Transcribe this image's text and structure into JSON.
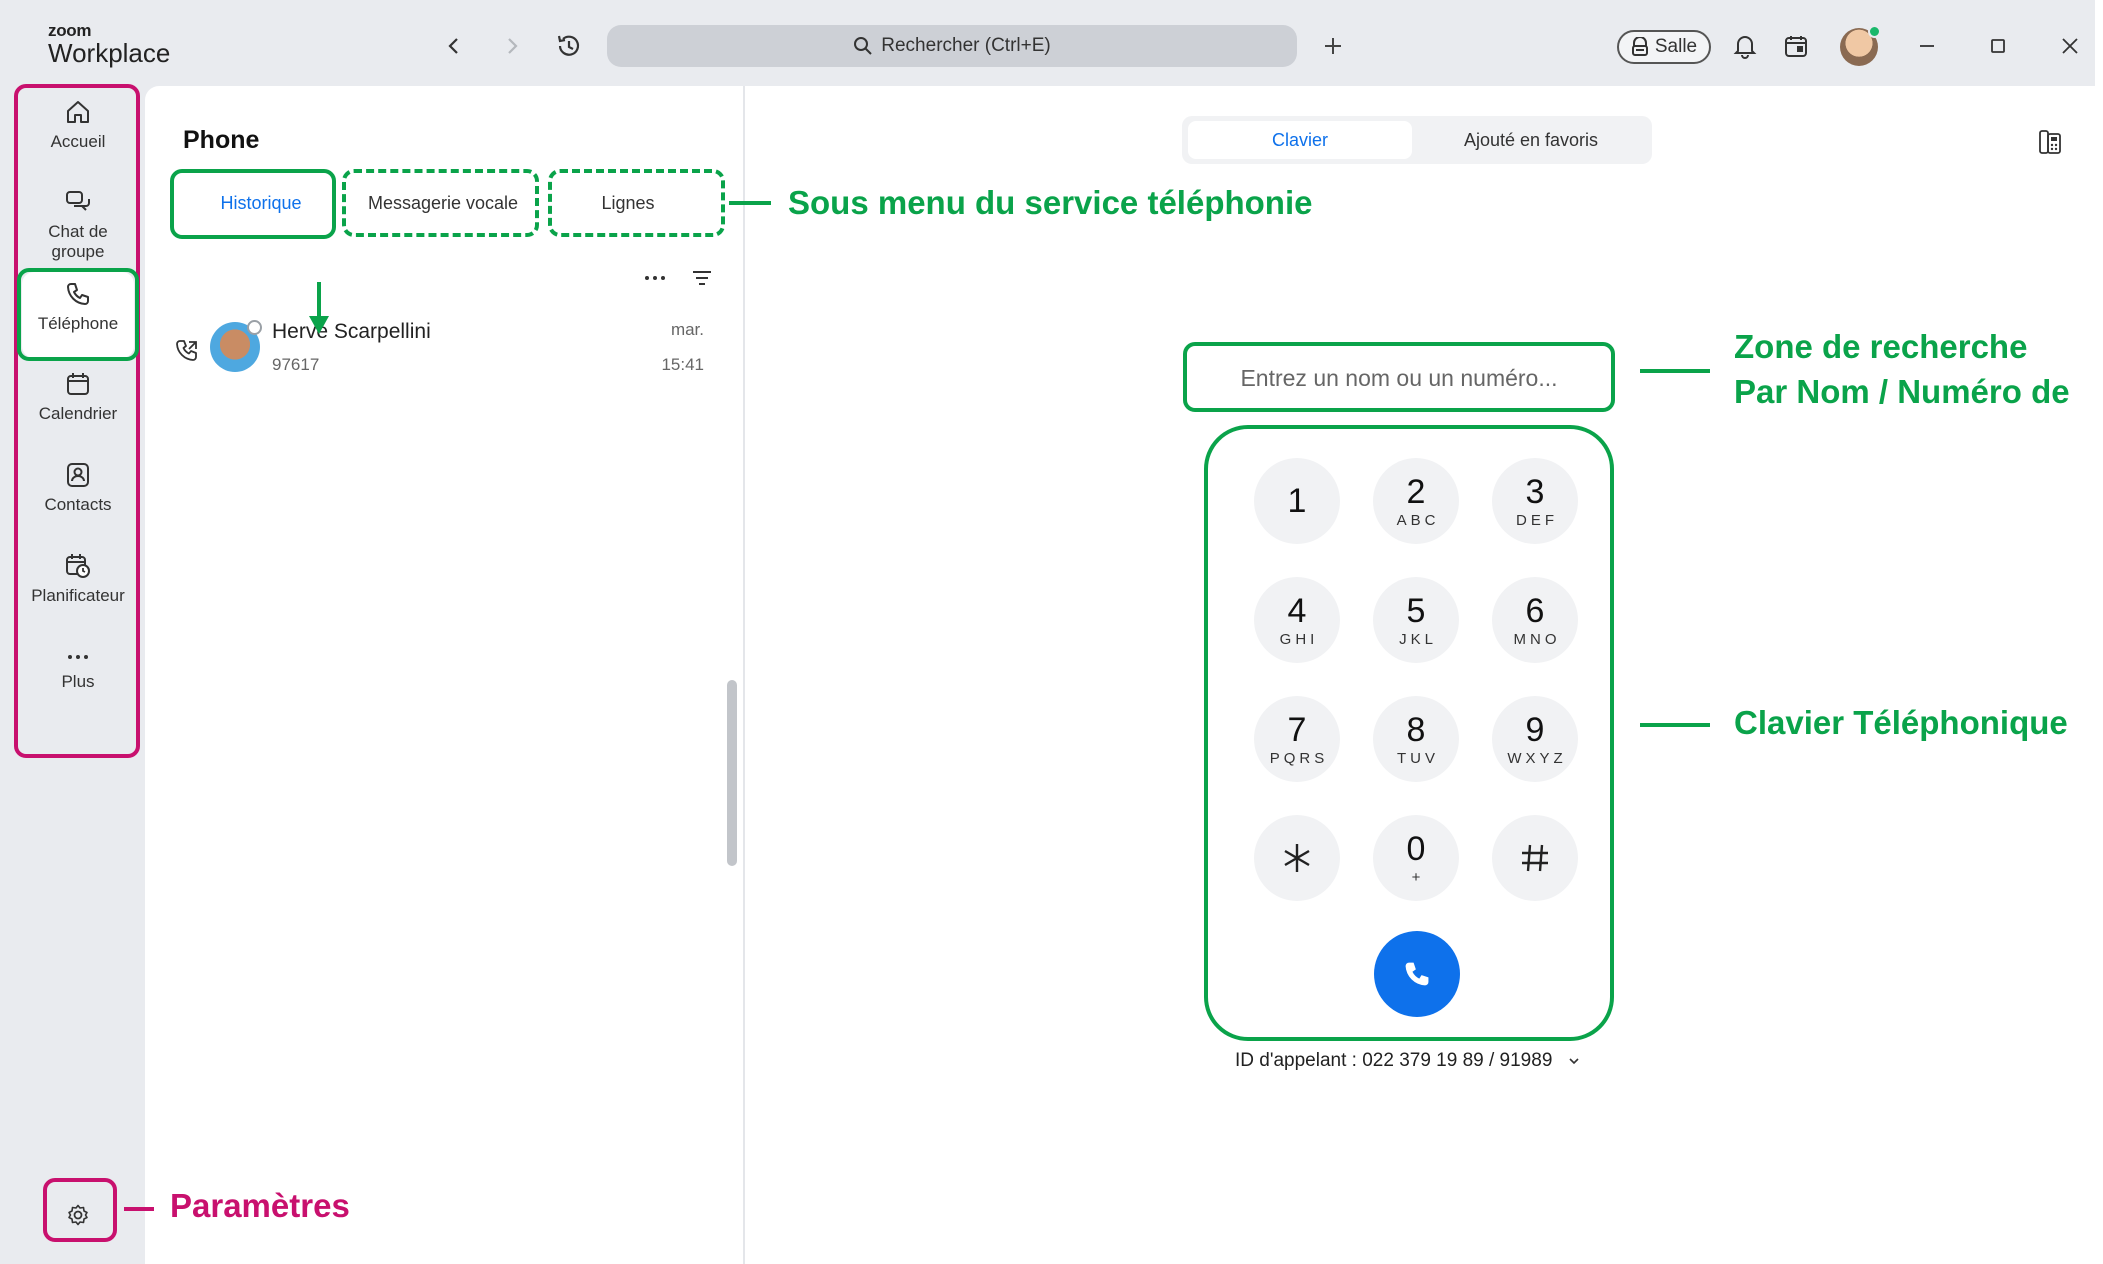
{
  "app": {
    "brand_small": "zoom",
    "brand_large": "Workplace"
  },
  "titlebar": {
    "search_label": "Rechercher (Ctrl+E)",
    "salle_label": "Salle"
  },
  "nav": {
    "items": [
      {
        "label": "Accueil",
        "icon": "home-icon"
      },
      {
        "label": "Chat de groupe",
        "icon": "chat-icon"
      },
      {
        "label": "Téléphone",
        "icon": "phone-icon"
      },
      {
        "label": "Calendrier",
        "icon": "calendar-icon"
      },
      {
        "label": "Contacts",
        "icon": "contacts-icon"
      },
      {
        "label": "Planificateur",
        "icon": "scheduler-icon"
      },
      {
        "label": "Plus",
        "icon": "more-icon"
      }
    ],
    "active": "Téléphone"
  },
  "phone": {
    "title": "Phone",
    "tabs": [
      "Historique",
      "Messagerie vocale",
      "Lignes"
    ],
    "active_tab": "Historique",
    "history": [
      {
        "name": "Hervé Scarpellini",
        "extension": "97617",
        "day": "mar.",
        "time": "15:41"
      }
    ]
  },
  "main": {
    "segments": [
      "Clavier",
      "Ajouté en favoris"
    ],
    "active_segment": "Clavier",
    "dial_placeholder": "Entrez un nom ou un numéro...",
    "keypad": [
      {
        "digit": "1",
        "letters": ""
      },
      {
        "digit": "2",
        "letters": "ABC"
      },
      {
        "digit": "3",
        "letters": "DEF"
      },
      {
        "digit": "4",
        "letters": "GHI"
      },
      {
        "digit": "5",
        "letters": "JKL"
      },
      {
        "digit": "6",
        "letters": "MNO"
      },
      {
        "digit": "7",
        "letters": "PQRS"
      },
      {
        "digit": "8",
        "letters": "TUV"
      },
      {
        "digit": "9",
        "letters": "WXYZ"
      },
      {
        "digit": "*",
        "letters": ""
      },
      {
        "digit": "0",
        "letters": "+"
      },
      {
        "digit": "#",
        "letters": ""
      }
    ],
    "caller_id": "ID d'appelant : 022 379 19 89 / 91989"
  },
  "annotations": {
    "submenu": "Sous menu du service téléphonie",
    "search_zone_line1": "Zone de recherche",
    "search_zone_line2": "Par Nom / Numéro de",
    "keypad": "Clavier Téléphonique",
    "settings": "Paramètres"
  },
  "colors": {
    "annotation_green": "#0aa34a",
    "annotation_magenta": "#c8106e",
    "accent_blue": "#0e71eb"
  }
}
